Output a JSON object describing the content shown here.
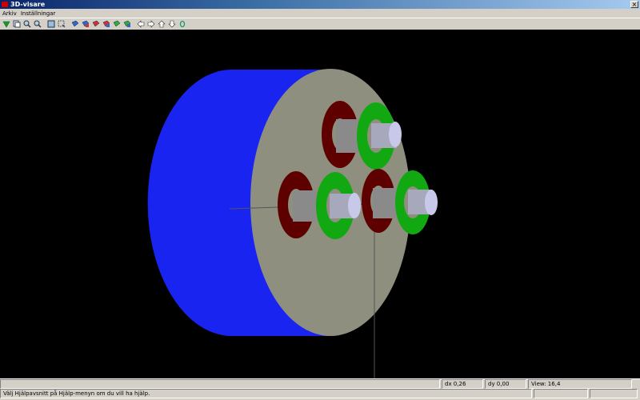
{
  "window": {
    "title": "3D-visare"
  },
  "menu": {
    "items": [
      "Arkiv",
      "Inställningar"
    ]
  },
  "toolbar": {
    "icons": [
      "play-down-icon",
      "copy-icon",
      "zoom-in-icon",
      "zoom-out-icon",
      "zoom-fit-icon",
      "zoom-window-icon",
      "view-1-icon",
      "view-2-icon",
      "view-3-icon",
      "view-4-icon",
      "view-5-icon",
      "view-6-icon",
      "arrow-left-icon",
      "arrow-right-icon",
      "arrow-up-icon",
      "arrow-down-icon",
      "reset-icon"
    ]
  },
  "status": {
    "dx": "dx 0,26",
    "dy": "dy 0,00",
    "view": "View: 16,4",
    "help": "Välj Hjälpavsnitt på Hjälp-menyn om du vill ha hjälp."
  },
  "colors": {
    "cylinder": "#1a24f0",
    "face": "#8f8f80",
    "ring_dark": "#5e0000",
    "ring_green": "#12a812",
    "pin": "#c8c8e8",
    "background": "#000000"
  }
}
